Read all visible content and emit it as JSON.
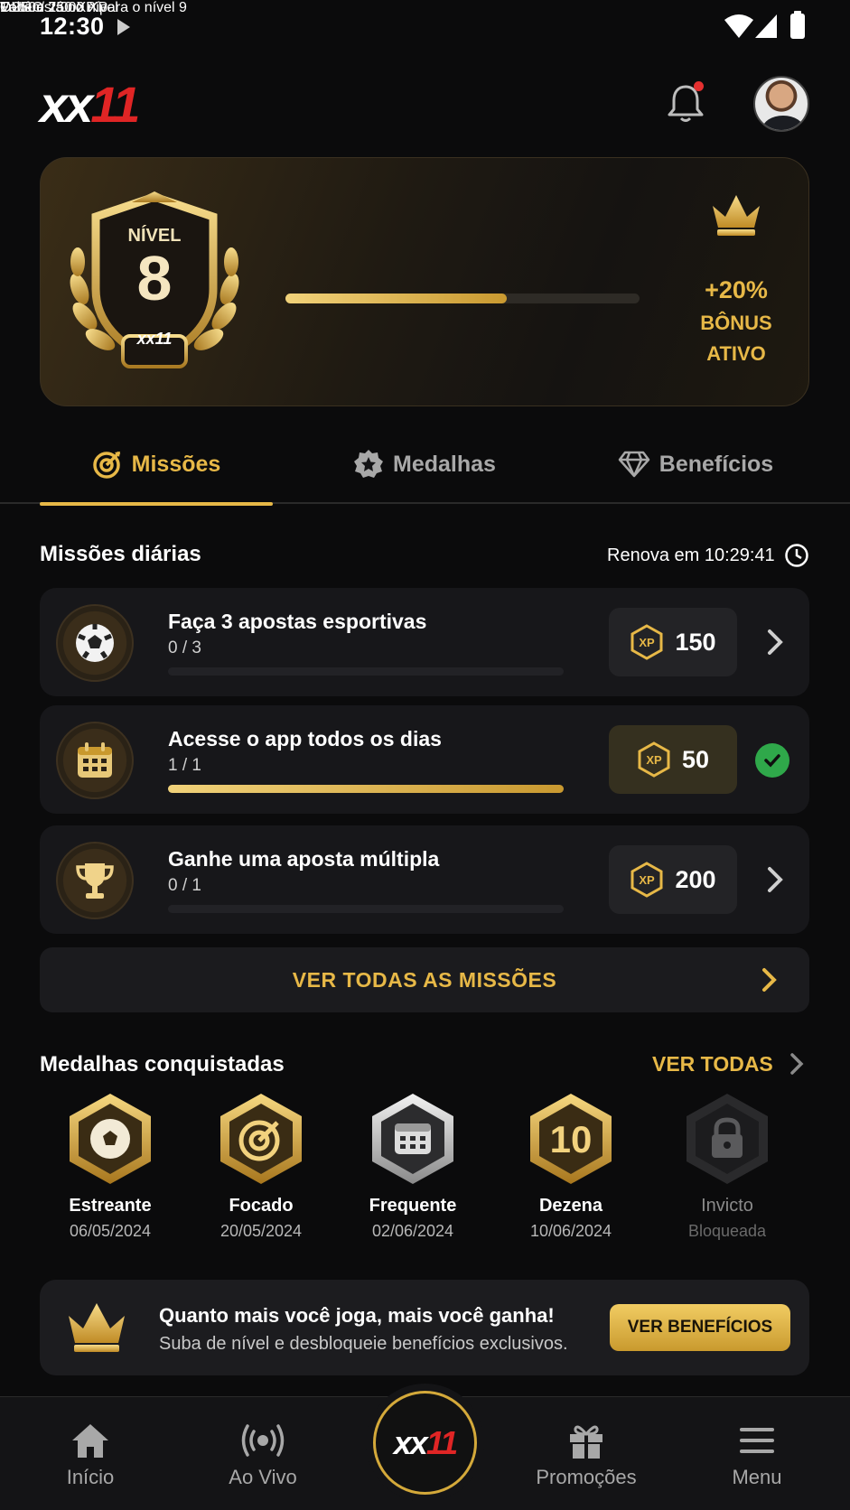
{
  "status_bar": {
    "time": "12:30"
  },
  "header": {
    "logo_main": "xx",
    "logo_accent": "11"
  },
  "level": {
    "prefix": "Você está no nível",
    "name": "OURO",
    "badge_label": "NÍVEL",
    "badge_number": "8",
    "badge_logo": "xx11",
    "progress": 0.625,
    "xp_current": "1.250 / 2.000",
    "xp_unit": "XP",
    "remaining": "Faltam 750 XP para o nível 9",
    "bonus_percent": "+20%",
    "bonus_line1": "BÔNUS",
    "bonus_line2": "ATIVO"
  },
  "tabs": [
    {
      "label": "Missões",
      "icon": "target-icon",
      "active": true
    },
    {
      "label": "Medalhas",
      "icon": "star-badge-icon",
      "active": false
    },
    {
      "label": "Benefícios",
      "icon": "diamond-icon",
      "active": false
    }
  ],
  "missions": {
    "title": "Missões diárias",
    "renew": "Renova em 10:29:41",
    "items": [
      {
        "title": "Faça 3 apostas esportivas",
        "progress_text": "0 / 3",
        "progress": 0,
        "xp_badge": "XP",
        "reward": "150",
        "icon": "soccer-ball-icon",
        "done": false
      },
      {
        "title": "Acesse o app todos os dias",
        "progress_text": "1 / 1",
        "progress": 1,
        "xp_badge": "XP",
        "reward": "50",
        "icon": "calendar-icon",
        "done": true
      },
      {
        "title": "Ganhe uma aposta múltipla",
        "progress_text": "0 / 1",
        "progress": 0,
        "xp_badge": "XP",
        "reward": "200",
        "icon": "trophy-icon",
        "done": false
      }
    ],
    "see_all": "VER TODAS AS MISSÕES"
  },
  "medals": {
    "title": "Medalhas conquistadas",
    "see_all": "VER TODAS",
    "items": [
      {
        "name": "Estreante",
        "date": "06/05/2024",
        "icon": "soccer-ball-icon",
        "tier": "gold"
      },
      {
        "name": "Focado",
        "date": "20/05/2024",
        "icon": "target-icon",
        "tier": "gold"
      },
      {
        "name": "Frequente",
        "date": "02/06/2024",
        "icon": "calendar-icon",
        "tier": "silver"
      },
      {
        "name": "Dezena",
        "date": "10/06/2024",
        "icon": "number-10-icon",
        "badge_text": "10",
        "tier": "gold"
      },
      {
        "name": "Invicto",
        "date": "Bloqueada",
        "icon": "lock-icon",
        "tier": "locked"
      }
    ]
  },
  "promo": {
    "headline": "Quanto mais você joga, mais você ganha!",
    "sub": "Suba de nível e desbloqueie benefícios exclusivos.",
    "button": "VER BENEFÍCIOS"
  },
  "nav": {
    "items": [
      {
        "label": "Início",
        "icon": "home-icon"
      },
      {
        "label": "Ao Vivo",
        "icon": "live-broadcast-icon"
      },
      {
        "label": "Promoções",
        "icon": "gift-icon"
      },
      {
        "label": "Menu",
        "icon": "menu-icon"
      }
    ],
    "center_main": "xx",
    "center_accent": "11"
  },
  "colors": {
    "accent": "#e7b847",
    "brand_red": "#e02525",
    "success": "#2fa84a",
    "background": "#0b0b0c"
  }
}
